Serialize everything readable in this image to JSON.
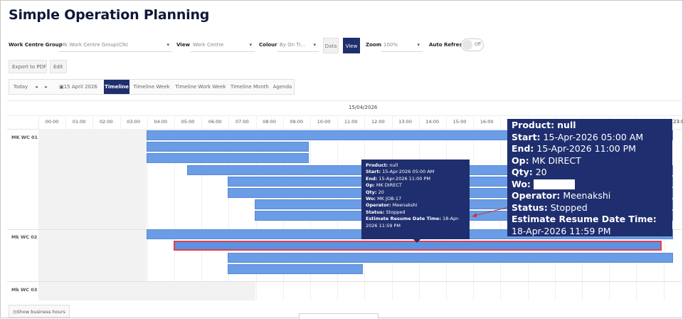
{
  "page": {
    "title": "Simple Operation Planning"
  },
  "toolbar": {
    "work_centre_group_label": "Work Centre Group",
    "work_centre_group_value": "Mk Work Centre Group(CN)",
    "view_label": "View",
    "view_value": "Work Centre",
    "colour_label": "Colour",
    "colour_value": "By On Ti...",
    "data_button": "Data",
    "view_button": "View",
    "zoom_label": "Zoom",
    "zoom_value": "100%",
    "auto_refresh_label": "Auto Refresh",
    "auto_refresh_state": "Off"
  },
  "actions": {
    "export_pdf": "Export to PDF",
    "edit": "Edit"
  },
  "nav": {
    "today": "Today",
    "prev": "◂",
    "next": "▸",
    "date": "15 April 2026",
    "views": [
      "Timeline",
      "Timeline Week",
      "Timeline Work Week",
      "Timeline Month",
      "Agenda"
    ],
    "active_view": "Timeline"
  },
  "scheduler": {
    "date_header": "15/04/2026",
    "hours": [
      "00:00",
      "01:00",
      "02:00",
      "03:00",
      "04:00",
      "05:00",
      "06:00",
      "07:00",
      "08:00",
      "09:00",
      "10:00",
      "11:00",
      "12:00",
      "13:00",
      "14:00",
      "15:00",
      "16:00"
    ],
    "last_hour_partial": "23:00",
    "resources": [
      "MK WC 01",
      "Mk WC 02",
      "Mk WC 03"
    ]
  },
  "tooltip": {
    "product_label": "Product:",
    "product_value": "null",
    "start_label": "Start:",
    "start_value": "15-Apr-2026 05:00 AM",
    "end_label": "End:",
    "end_value": "15-Apr-2026 11:00 PM",
    "op_label": "Op:",
    "op_value": "MK DIRECT",
    "qty_label": "Qty:",
    "qty_value": "20",
    "wo_label": "Wo:",
    "wo_value": "MK JOB-17",
    "operator_label": "Operator:",
    "operator_value": "Meenakshi",
    "status_label": "Status:",
    "status_value": "Stopped",
    "resume_label": "Estimate Resume Date Time:",
    "resume_value": "18-Apr-2026 11:59 PM"
  },
  "footer": {
    "show_business_hours": "Show business hours"
  },
  "colors": {
    "accent": "#1f2e6e",
    "bar": "#6a9de6",
    "selected_border": "#e04050"
  }
}
